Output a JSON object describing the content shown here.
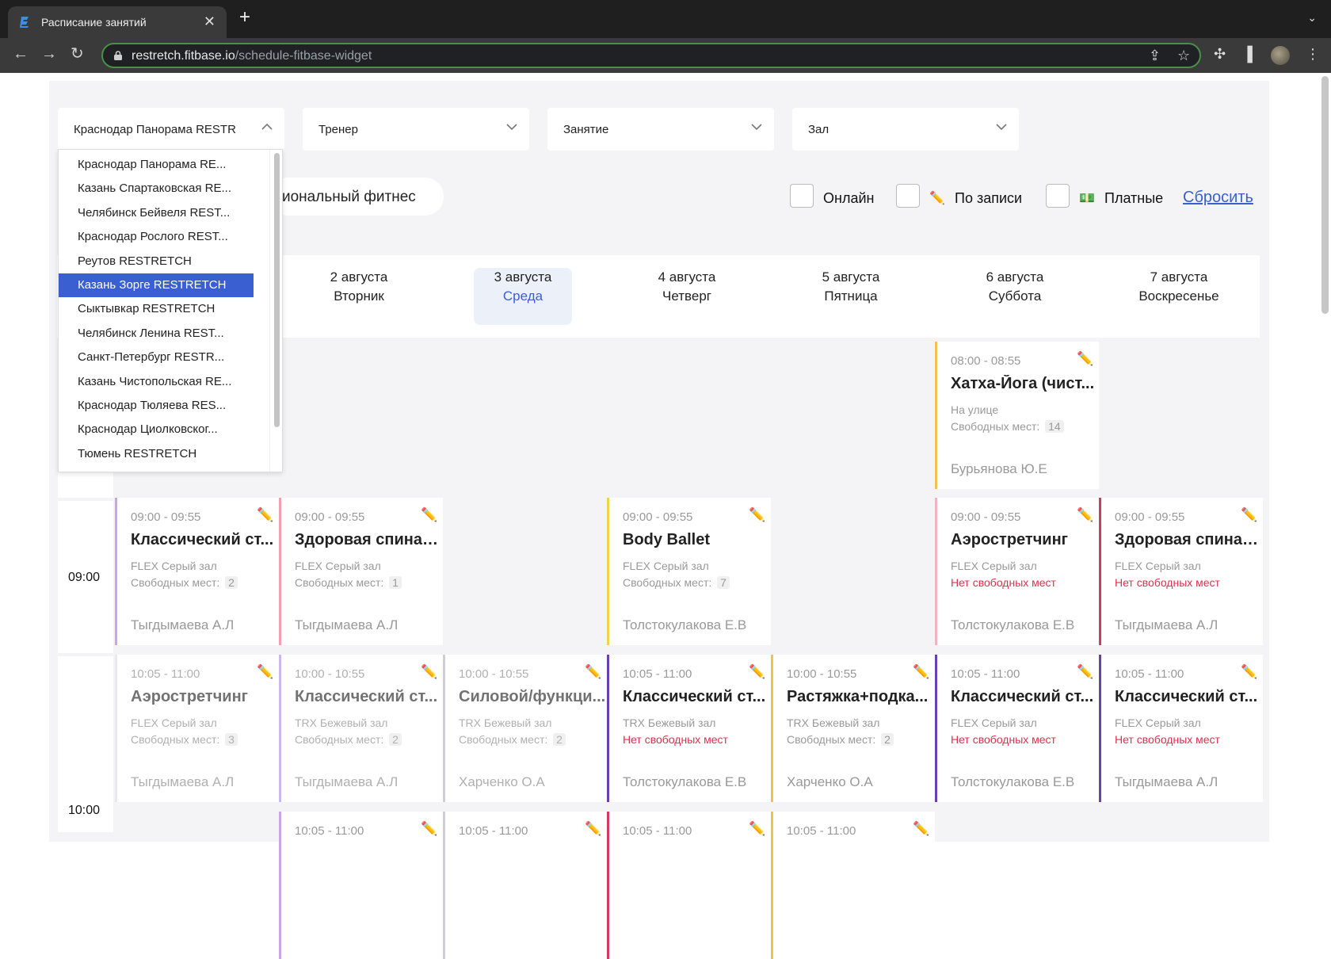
{
  "browser": {
    "tab_title": "Расписание занятий",
    "url_host": "restretch.fitbase.io",
    "url_path": "/schedule-fitbase-widget"
  },
  "filters": {
    "club": "Краснодар Панорама RESTR",
    "trainer": "Тренер",
    "lesson": "Занятие",
    "hall": "Зал",
    "category_chip": "иональный фитнес",
    "online_label": "Онлайн",
    "booking_label": "По записи",
    "paid_label": "Платные",
    "booking_icon": "✏️",
    "paid_icon": "💵",
    "reset_label": "Сбросить"
  },
  "dropdown": {
    "options": [
      "Краснодар Панорама RE...",
      "Казань Спартаковская RE...",
      "Челябинск Бейвеля REST...",
      "Краснодар Рослого REST...",
      "Реутов RESTRETCH",
      "Казань Зорге RESTRETCH",
      "Сыктывкар RESTRETCH",
      "Челябинск Ленина REST...",
      "Санкт-Петербург RESTR...",
      "Казань Чистопольская RE...",
      "Краснодар Тюляева RES...",
      "Краснодар Циолковског...",
      "Тюмень RESTRETCH"
    ],
    "highlighted": "Казань Зорге RESTRETCH"
  },
  "days": [
    {
      "date": "2 августа",
      "name": "Вторник"
    },
    {
      "date": "3 августа",
      "name": "Среда"
    },
    {
      "date": "4 августа",
      "name": "Четверг"
    },
    {
      "date": "5 августа",
      "name": "Пятница"
    },
    {
      "date": "6 августа",
      "name": "Суббота"
    },
    {
      "date": "7 августа",
      "name": "Воскресенье"
    }
  ],
  "times": [
    "09:00",
    "10:00"
  ],
  "labels": {
    "free_places": "Свободных мест:",
    "no_places": "Нет свободных мест"
  },
  "cards": [
    {
      "time": "08:00 - 08:55",
      "name": "Хатха-Йога (чист...",
      "room": "На улице",
      "free": "14",
      "trainer": "Бурьянова Ю.Е",
      "color": "#f2c14e"
    },
    {
      "time": "09:00 - 09:55",
      "name": "Классический ст...",
      "room": "FLEX Серый зал",
      "free": "2",
      "trainer": "Тыгдымаева А.Л",
      "color": "#c9a6e6"
    },
    {
      "time": "09:00 - 09:55",
      "name": "Здоровая спина в...",
      "room": "FLEX Серый зал",
      "free": "1",
      "trainer": "Тыгдымаева А.Л",
      "color": "#f0a0b0"
    },
    {
      "time": "09:00 - 09:55",
      "name": "Body Ballet",
      "room": "FLEX Серый зал",
      "free": "7",
      "trainer": "Толстокулакова Е.В",
      "color": "#f2d546"
    },
    {
      "time": "09:00 - 09:55",
      "name": "Аэростретчинг",
      "room": "FLEX Серый зал",
      "full": true,
      "trainer": "Толстокулакова Е.В",
      "color": "#f0b3c0"
    },
    {
      "time": "09:00 - 09:55",
      "name": "Здоровая спина в...",
      "room": "FLEX Серый зал",
      "full": true,
      "trainer": "Тыгдымаева А.Л",
      "color": "#d43a5e"
    },
    {
      "time": "10:05 - 11:00",
      "name": "Аэростретчинг",
      "room": "FLEX Серый зал",
      "free": "3",
      "trainer": "Тыгдымаева А.Л",
      "color": "#e8e8ee"
    },
    {
      "time": "10:00 - 10:55",
      "name": "Классический ст...",
      "room": "TRX Бежевый зал",
      "free": "2",
      "trainer": "Тыгдымаева А.Л",
      "color": "#cbb8ee"
    },
    {
      "time": "10:00 - 10:55",
      "name": "Силовой/функци...",
      "room": "TRX Бежевый зал",
      "free": "2",
      "trainer": "Харченко О.А",
      "color": "#d0d0d4"
    },
    {
      "time": "10:05 - 11:00",
      "name": "Классический ст...",
      "room": "TRX Бежевый зал",
      "full": true,
      "trainer": "Толстокулакова Е.В",
      "color": "#6b3fb0"
    },
    {
      "time": "10:00 - 10:55",
      "name": "Растяжка+подка...",
      "room": "TRX Бежевый зал",
      "free": "2",
      "trainer": "Харченко О.А",
      "color": "#f2c14e"
    },
    {
      "time": "10:05 - 11:00",
      "name": "Классический ст...",
      "room": "FLEX Серый зал",
      "full": true,
      "trainer": "Толстокулакова Е.В",
      "color": "#6b3fb0"
    },
    {
      "time": "10:05 - 11:00",
      "name": "Классический ст...",
      "room": "FLEX Серый зал",
      "full": true,
      "trainer": "Тыгдымаева А.Л",
      "color": "#6b3fb0"
    },
    {
      "time": "10:05 - 11:00",
      "color": "#c9a6e6"
    },
    {
      "time": "10:05 - 11:00",
      "color": "#d0d0d4"
    },
    {
      "time": "10:05 - 11:00",
      "color": "#d43a5e"
    },
    {
      "time": "10:05 - 11:00",
      "color": "#f2c14e"
    }
  ]
}
